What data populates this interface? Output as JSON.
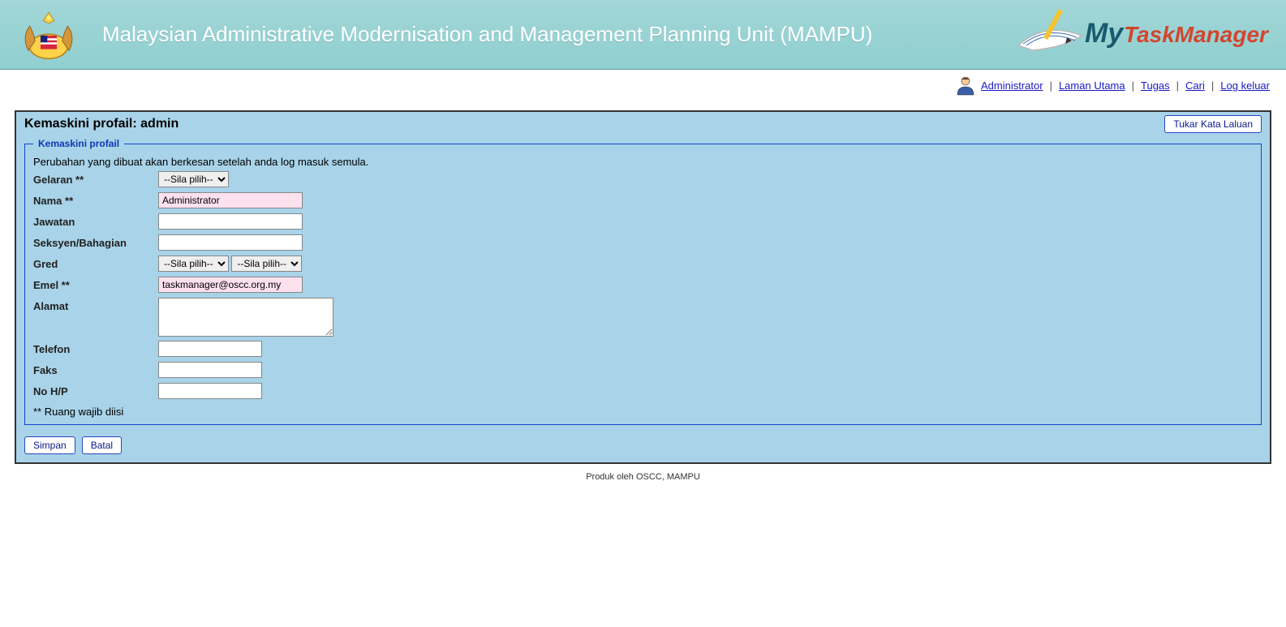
{
  "header": {
    "title": "Malaysian Administrative Modernisation and Management Planning Unit (MAMPU)",
    "logo_text1": "My",
    "logo_text2": "TaskManager"
  },
  "topnav": {
    "user": "Administrator",
    "links": {
      "home": "Laman Utama",
      "tasks": "Tugas",
      "search": "Cari",
      "logout": "Log keluar"
    },
    "sep": "|"
  },
  "page": {
    "title": "Kemaskini profail: admin",
    "change_password": "Tukar Kata Laluan"
  },
  "fieldset": {
    "legend": "Kemaskini profail",
    "notice": "Perubahan yang dibuat akan berkesan setelah anda log masuk semula.",
    "req_note": "** Ruang wajib diisi"
  },
  "form": {
    "labels": {
      "gelaran": "Gelaran **",
      "nama": "Nama **",
      "jawatan": "Jawatan",
      "seksyen": "Seksyen/Bahagian",
      "gred": "Gred",
      "emel": "Emel **",
      "alamat": "Alamat",
      "telefon": "Telefon",
      "faks": "Faks",
      "nohp": "No H/P"
    },
    "values": {
      "gelaran": "--Sila pilih--",
      "nama": "Administrator",
      "jawatan": "",
      "seksyen": "",
      "gred1": "--Sila pilih--",
      "gred2": "--Sila pilih--",
      "emel": "taskmanager@oscc.org.my",
      "alamat": "",
      "telefon": "",
      "faks": "",
      "nohp": ""
    }
  },
  "actions": {
    "save": "Simpan",
    "cancel": "Batal"
  },
  "footer": {
    "text": "Produk oleh OSCC, MAMPU"
  }
}
